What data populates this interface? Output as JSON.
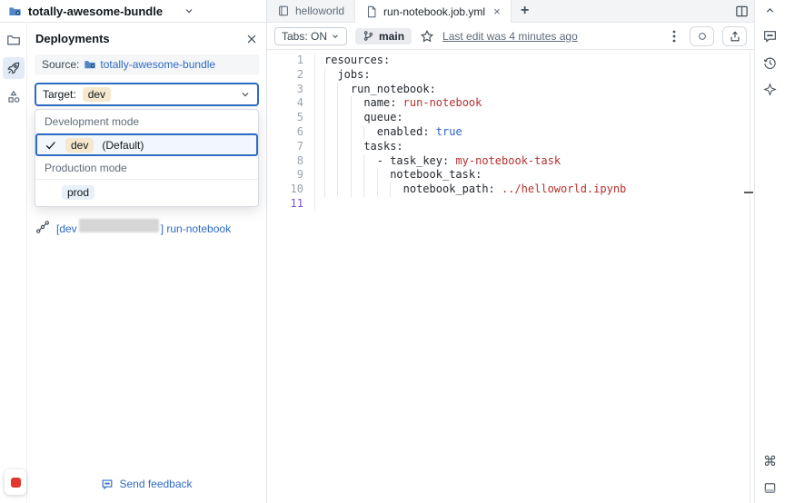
{
  "colors": {
    "accent": "#2f6bc4",
    "link": "#2f6bc4",
    "dev_badge_bg": "#f5e8cd",
    "prod_badge_bg": "#e8f0fa",
    "selected_item_bg": "#f2f7fd",
    "code_key": "#24292f",
    "code_value": "#b5312f",
    "code_bool": "#2b5fc7",
    "line_number": "#9aa3ad",
    "active_line_number": "#8250df",
    "record_indicator": "#e0372e"
  },
  "window": {
    "bundle_title": "totally-awesome-bundle"
  },
  "sidebar": {
    "items": [
      {
        "name": "folder"
      },
      {
        "name": "deployments",
        "selected": true
      },
      {
        "name": "resources"
      }
    ]
  },
  "panel": {
    "title": "Deployments",
    "source_label": "Source:",
    "source_link": "totally-awesome-bundle",
    "target_label": "Target:",
    "target_value": "dev",
    "dropdown": {
      "sections": [
        {
          "header": "Development mode",
          "items": [
            {
              "label": "dev",
              "suffix": "(Default)",
              "selected": true
            }
          ]
        },
        {
          "header": "Production mode",
          "items": [
            {
              "label": "prod",
              "selected": false
            }
          ]
        }
      ]
    },
    "run_link": {
      "prefix": "[dev",
      "suffix": "] run-notebook"
    },
    "feedback": "Send feedback"
  },
  "editor": {
    "tabs": [
      {
        "label": "helloworld",
        "icon": "notebook",
        "active": false
      },
      {
        "label": "run-notebook.job.yml",
        "icon": "file",
        "active": true,
        "close": "×"
      }
    ],
    "new_tab": "+",
    "toolbar": {
      "tabs_toggle": "Tabs: ON",
      "branch": "main",
      "last_edit": "Last edit was 4 minutes ago"
    },
    "code": {
      "language": "yaml",
      "lines": [
        {
          "num": 1,
          "guides": 0,
          "parts": [
            [
              "resources:",
              "key"
            ]
          ]
        },
        {
          "num": 2,
          "guides": 1,
          "parts": [
            [
              "jobs:",
              "key"
            ]
          ]
        },
        {
          "num": 3,
          "guides": 2,
          "parts": [
            [
              "run_notebook:",
              "key"
            ]
          ]
        },
        {
          "num": 4,
          "guides": 3,
          "parts": [
            [
              "name: ",
              "key"
            ],
            [
              "run-notebook",
              "val"
            ]
          ]
        },
        {
          "num": 5,
          "guides": 3,
          "parts": [
            [
              "queue:",
              "key"
            ]
          ]
        },
        {
          "num": 6,
          "guides": 4,
          "parts": [
            [
              "enabled: ",
              "key"
            ],
            [
              "true",
              "bool"
            ]
          ]
        },
        {
          "num": 7,
          "guides": 3,
          "parts": [
            [
              "tasks:",
              "key"
            ]
          ]
        },
        {
          "num": 8,
          "guides": 4,
          "parts": [
            [
              "- task_key: ",
              "key"
            ],
            [
              "my-notebook-task",
              "val"
            ]
          ]
        },
        {
          "num": 9,
          "guides": 5,
          "parts": [
            [
              "notebook_task:",
              "key"
            ]
          ]
        },
        {
          "num": 10,
          "guides": 6,
          "parts": [
            [
              "notebook_path: ",
              "key"
            ],
            [
              "../helloworld.ipynb",
              "val"
            ]
          ]
        },
        {
          "num": 11,
          "guides": 0,
          "active": true,
          "parts": []
        }
      ]
    }
  }
}
